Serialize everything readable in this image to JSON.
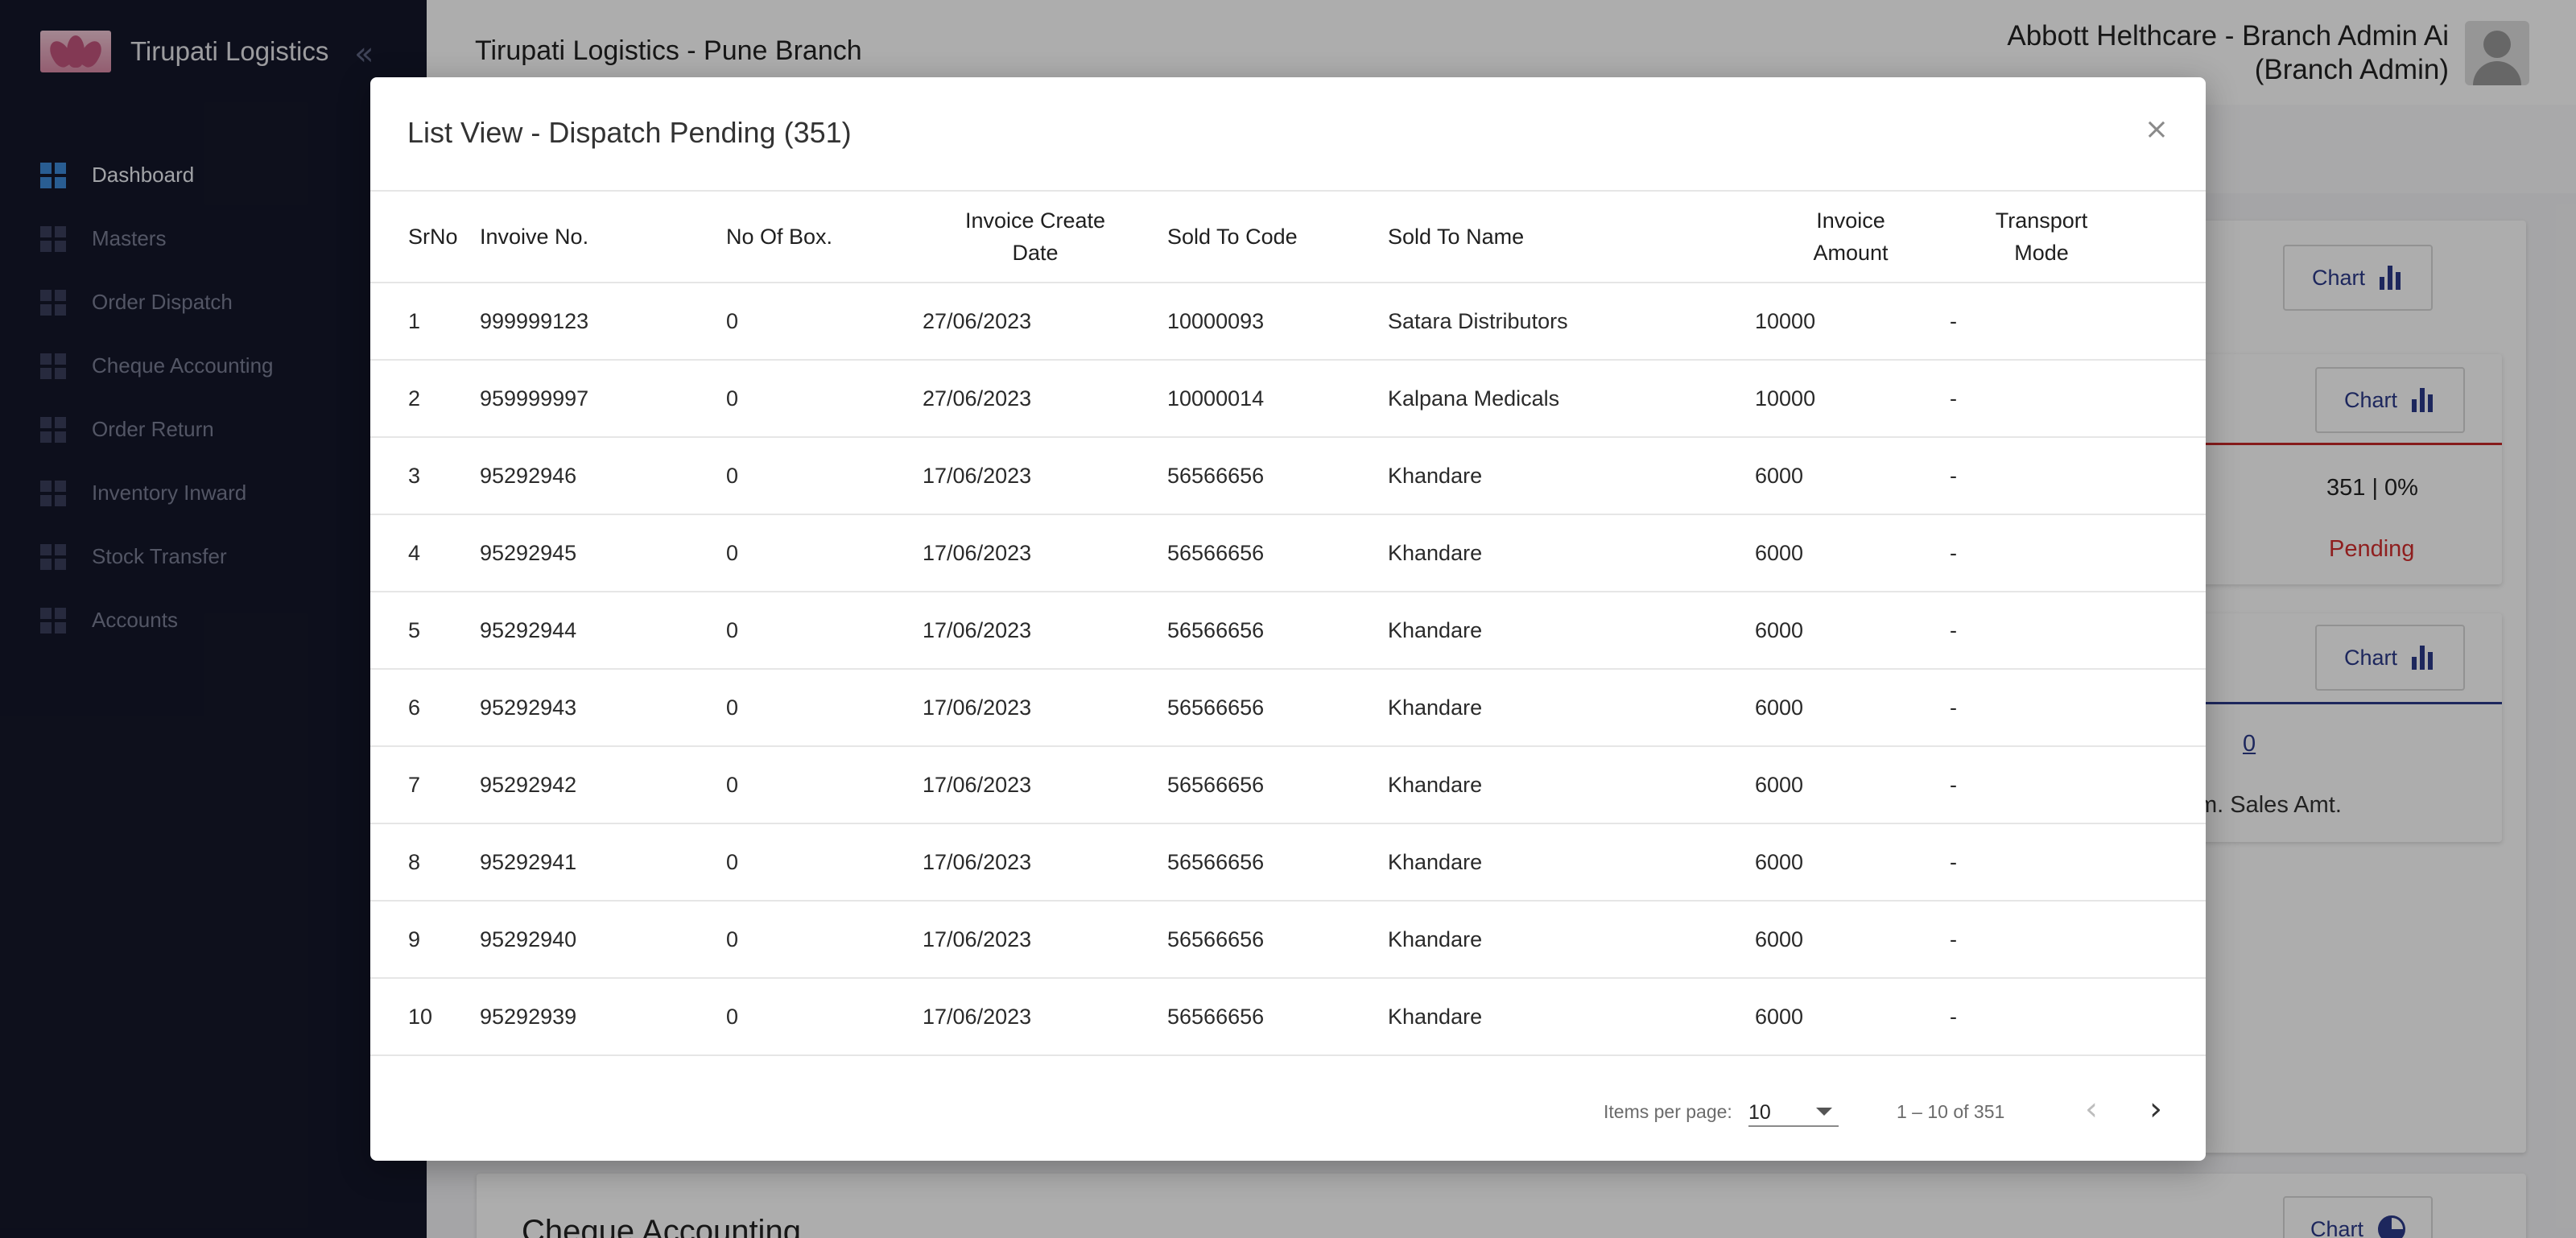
{
  "sidebar": {
    "brand": "Tirupati Logistics",
    "items": [
      {
        "label": "Dashboard",
        "active": true
      },
      {
        "label": "Masters"
      },
      {
        "label": "Order Dispatch"
      },
      {
        "label": "Cheque Accounting"
      },
      {
        "label": "Order Return"
      },
      {
        "label": "Inventory Inward"
      },
      {
        "label": "Stock Transfer"
      },
      {
        "label": "Accounts"
      }
    ]
  },
  "header": {
    "title": "Tirupati Logistics - Pune Branch",
    "user_name": "Abbott Helthcare - Branch Admin Ai",
    "user_role": "(Branch Admin)"
  },
  "background": {
    "chart_label": "Chart",
    "stat_value": "351 | 0%",
    "stat_status": "Pending",
    "stat_status_color": "#d32f2f",
    "zero_link": "0",
    "sales_label": "m. Sales Amt.",
    "section_title": "Cheque Accounting"
  },
  "modal": {
    "title": "List View - Dispatch Pending (351)",
    "close": "×",
    "columns": [
      "SrNo",
      "Invoive No.",
      "No Of Box.",
      "Invoice Create Date",
      "Sold To Code",
      "Sold To Name",
      "Invoice Amount",
      "Transport Mode"
    ],
    "rows": [
      [
        "1",
        "999999123",
        "0",
        "27/06/2023",
        "10000093",
        "Satara Distributors",
        "10000",
        "-"
      ],
      [
        "2",
        "959999997",
        "0",
        "27/06/2023",
        "10000014",
        "Kalpana Medicals",
        "10000",
        "-"
      ],
      [
        "3",
        "95292946",
        "0",
        "17/06/2023",
        "56566656",
        "Khandare",
        "6000",
        "-"
      ],
      [
        "4",
        "95292945",
        "0",
        "17/06/2023",
        "56566656",
        "Khandare",
        "6000",
        "-"
      ],
      [
        "5",
        "95292944",
        "0",
        "17/06/2023",
        "56566656",
        "Khandare",
        "6000",
        "-"
      ],
      [
        "6",
        "95292943",
        "0",
        "17/06/2023",
        "56566656",
        "Khandare",
        "6000",
        "-"
      ],
      [
        "7",
        "95292942",
        "0",
        "17/06/2023",
        "56566656",
        "Khandare",
        "6000",
        "-"
      ],
      [
        "8",
        "95292941",
        "0",
        "17/06/2023",
        "56566656",
        "Khandare",
        "6000",
        "-"
      ],
      [
        "9",
        "95292940",
        "0",
        "17/06/2023",
        "56566656",
        "Khandare",
        "6000",
        "-"
      ],
      [
        "10",
        "95292939",
        "0",
        "17/06/2023",
        "56566656",
        "Khandare",
        "6000",
        "-"
      ]
    ]
  },
  "paginator": {
    "items_per_page_label": "Items per page:",
    "items_per_page": "10",
    "range": "1 – 10 of 351",
    "prev": "‹",
    "next": "›"
  }
}
